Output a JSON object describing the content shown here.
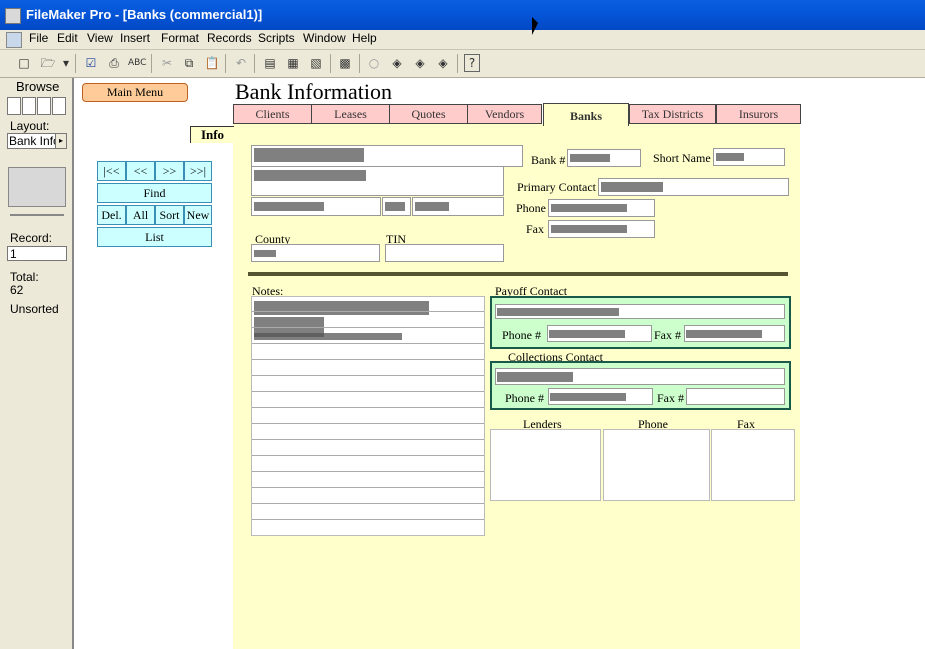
{
  "window": {
    "title": "FileMaker Pro - [Banks (commercial1)]"
  },
  "menu": [
    "File",
    "Edit",
    "View",
    "Insert",
    "Format",
    "Records",
    "Scripts",
    "Window",
    "Help"
  ],
  "status": {
    "mode": "Browse",
    "layout_label": "Layout:",
    "layout_value": "Bank Info",
    "record_label": "Record:",
    "record_value": "1",
    "total_label": "Total:",
    "total_value": "62",
    "sort_state": "Unsorted"
  },
  "layout": {
    "main_menu_label": "Main Menu",
    "info_label": "Info",
    "heading": "Bank Information",
    "tabs": [
      "Clients",
      "Leases",
      "Quotes",
      "Vendors",
      "Banks",
      "Tax Districts",
      "Insurors"
    ],
    "active_tab": "Banks",
    "nav": {
      "first": "|<<",
      "prev": "<<",
      "next": ">>",
      "last": ">>|",
      "find": "Find",
      "del": "Del.",
      "all": "All",
      "sort": "Sort",
      "new": "New",
      "list": "List"
    },
    "labels": {
      "bank_no": "Bank #",
      "short_name": "Short Name",
      "primary_contact": "Primary Contact",
      "phone": "Phone",
      "fax": "Fax",
      "county": "County",
      "tin": "TIN",
      "notes": "Notes:",
      "payoff_contact": "Payoff Contact",
      "payoff_phone": "Phone #",
      "payoff_fax": "Fax #",
      "collections_contact": "Collections Contact",
      "coll_phone": "Phone #",
      "coll_fax": "Fax #",
      "lenders": "Lenders",
      "lenders_phone": "Phone",
      "lenders_fax": "Fax"
    }
  }
}
